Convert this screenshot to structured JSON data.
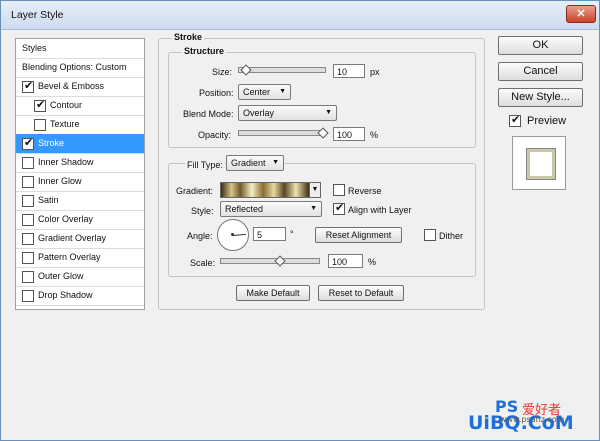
{
  "window": {
    "title": "Layer Style",
    "close_glyph": "✕"
  },
  "styles_panel": {
    "items": [
      {
        "label": "Styles",
        "checkbox": false,
        "checked": false,
        "indent": 0,
        "selected": false
      },
      {
        "label": "Blending Options: Custom",
        "checkbox": false,
        "checked": false,
        "indent": 0,
        "selected": false
      },
      {
        "label": "Bevel & Emboss",
        "checkbox": true,
        "checked": true,
        "indent": 0,
        "selected": false
      },
      {
        "label": "Contour",
        "checkbox": true,
        "checked": true,
        "indent": 1,
        "selected": false
      },
      {
        "label": "Texture",
        "checkbox": true,
        "checked": false,
        "indent": 1,
        "selected": false
      },
      {
        "label": "Stroke",
        "checkbox": true,
        "checked": true,
        "indent": 0,
        "selected": true
      },
      {
        "label": "Inner Shadow",
        "checkbox": true,
        "checked": false,
        "indent": 0,
        "selected": false
      },
      {
        "label": "Inner Glow",
        "checkbox": true,
        "checked": false,
        "indent": 0,
        "selected": false
      },
      {
        "label": "Satin",
        "checkbox": true,
        "checked": false,
        "indent": 0,
        "selected": false
      },
      {
        "label": "Color Overlay",
        "checkbox": true,
        "checked": false,
        "indent": 0,
        "selected": false
      },
      {
        "label": "Gradient Overlay",
        "checkbox": true,
        "checked": false,
        "indent": 0,
        "selected": false
      },
      {
        "label": "Pattern Overlay",
        "checkbox": true,
        "checked": false,
        "indent": 0,
        "selected": false
      },
      {
        "label": "Outer Glow",
        "checkbox": true,
        "checked": false,
        "indent": 0,
        "selected": false
      },
      {
        "label": "Drop Shadow",
        "checkbox": true,
        "checked": false,
        "indent": 0,
        "selected": false
      }
    ]
  },
  "stroke": {
    "title": "Stroke",
    "structure": {
      "title": "Structure",
      "size_label": "Size:",
      "size_value": "10",
      "size_unit": "px",
      "size_fraction": 0.04,
      "position_label": "Position:",
      "position_value": "Center",
      "blend_label": "Blend Mode:",
      "blend_value": "Overlay",
      "opacity_label": "Opacity:",
      "opacity_value": "100",
      "opacity_unit": "%",
      "opacity_fraction": 1.0
    },
    "fill": {
      "filltype_label": "Fill Type:",
      "filltype_value": "Gradient",
      "gradient_label": "Gradient:",
      "reverse_label": "Reverse",
      "reverse_checked": false,
      "style_label": "Style:",
      "style_value": "Reflected",
      "align_label": "Align with Layer",
      "align_checked": true,
      "angle_label": "Angle:",
      "angle_value": "5",
      "angle_unit": "°",
      "reset_alignment": "Reset Alignment",
      "dither_label": "Dither",
      "dither_checked": false,
      "scale_label": "Scale:",
      "scale_value": "100",
      "scale_unit": "%",
      "scale_fraction": 0.6
    },
    "make_default": "Make Default",
    "reset_default": "Reset to Default"
  },
  "right": {
    "ok": "OK",
    "cancel": "Cancel",
    "new_style": "New Style...",
    "preview_label": "Preview",
    "preview_checked": true
  },
  "watermark": {
    "ps": "PS",
    "cn": "爱好者",
    "brand": "UiBQ.CoM",
    "site": "www.psahz.com"
  },
  "colors": {
    "selection": "#3399ff",
    "brand_blue": "#1e6fd9",
    "brand_red": "#e33"
  }
}
